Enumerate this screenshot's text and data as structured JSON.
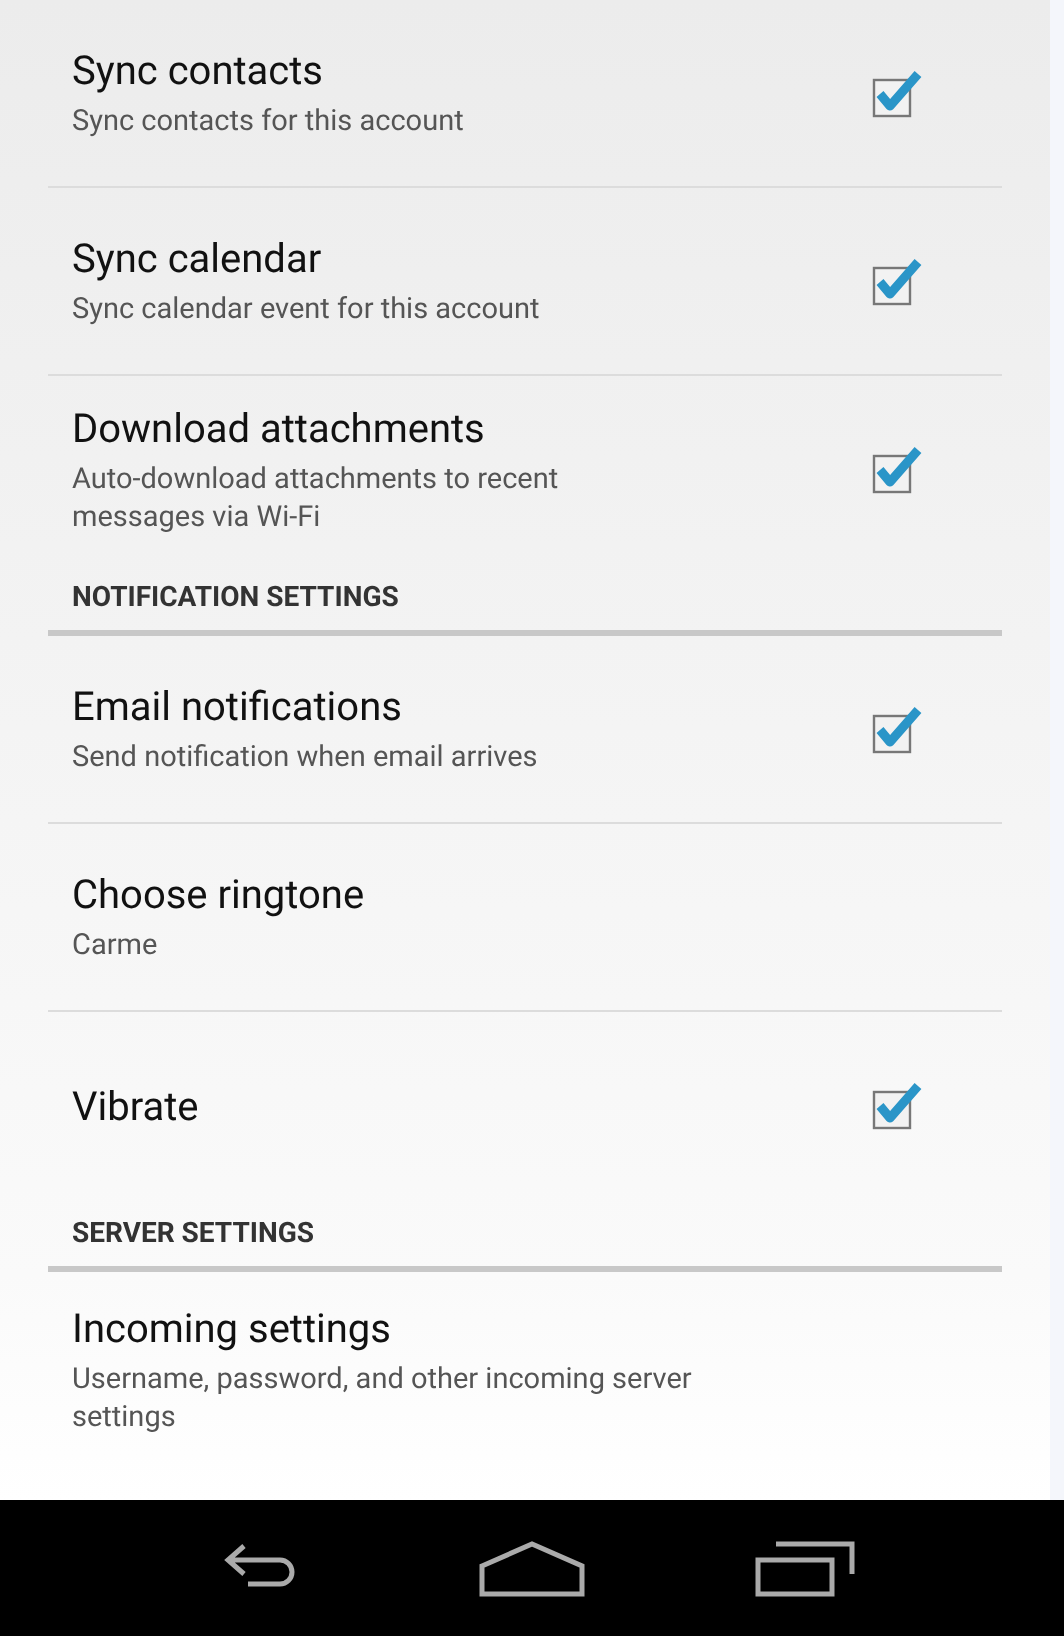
{
  "items": [
    {
      "kind": "checkbox",
      "title": "Sync contacts",
      "summary": "Sync contacts for this account",
      "checked": true
    },
    {
      "kind": "checkbox",
      "title": "Sync calendar",
      "summary": "Sync calendar event for this account",
      "checked": true
    },
    {
      "kind": "checkbox",
      "title": "Download attachments",
      "summary": "Auto-download attachments to recent messages via Wi-Fi",
      "checked": true
    },
    {
      "kind": "header",
      "title": "NOTIFICATION SETTINGS"
    },
    {
      "kind": "checkbox",
      "title": "Email notifications",
      "summary": "Send notification when email arrives",
      "checked": true
    },
    {
      "kind": "plain",
      "title": "Choose ringtone",
      "summary": "Carme"
    },
    {
      "kind": "checkbox",
      "title": "Vibrate",
      "checked": true
    },
    {
      "kind": "header",
      "title": "SERVER SETTINGS"
    },
    {
      "kind": "plain",
      "title": "Incoming settings",
      "summary": "Username, password, and other incoming server settings"
    }
  ]
}
